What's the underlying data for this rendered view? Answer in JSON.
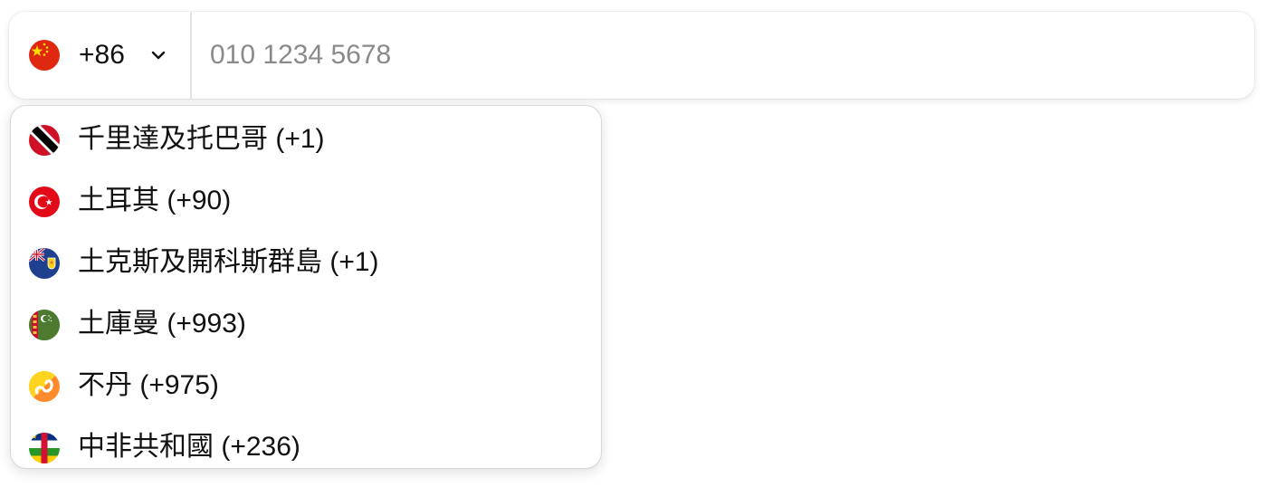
{
  "phone_field": {
    "selected_country": {
      "flag": "china-flag-icon",
      "code": "+86"
    },
    "chevron": "chevron-down-icon",
    "placeholder": "010 1234 5678",
    "value": ""
  },
  "dropdown": {
    "options": [
      {
        "label": "千里達及托巴哥 (+1)",
        "flag": "trinidad-and-tobago-flag-icon"
      },
      {
        "label": "土耳其 (+90)",
        "flag": "turkey-flag-icon"
      },
      {
        "label": "土克斯及開科斯群島 (+1)",
        "flag": "turks-and-caicos-flag-icon"
      },
      {
        "label": "土庫曼 (+993)",
        "flag": "turkmenistan-flag-icon"
      },
      {
        "label": "不丹 (+975)",
        "flag": "bhutan-flag-icon"
      },
      {
        "label": "中非共和國 (+236)",
        "flag": "central-african-republic-flag-icon"
      }
    ]
  }
}
